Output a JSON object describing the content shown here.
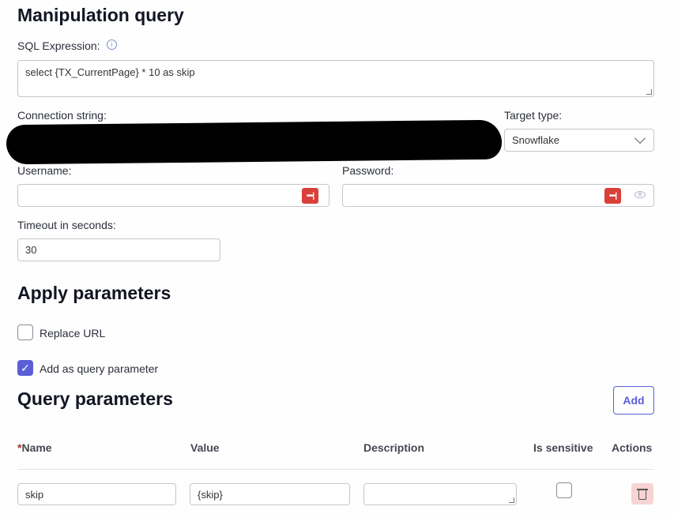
{
  "manipulation": {
    "title": "Manipulation query",
    "sql_label": "SQL Expression:",
    "sql_value": "select {TX_CurrentPage} * 10 as skip",
    "connection_label": "Connection string:",
    "target_label": "Target type:",
    "target_value": "Snowflake",
    "username_label": "Username:",
    "username_value": "",
    "password_label": "Password:",
    "password_value": "",
    "timeout_label": "Timeout in seconds:",
    "timeout_value": "30"
  },
  "apply": {
    "title": "Apply parameters",
    "replace_url_label": "Replace URL",
    "replace_url_checked": false,
    "add_query_label": "Add as query parameter",
    "add_query_checked": true
  },
  "query_params": {
    "title": "Query parameters",
    "add_label": "Add",
    "required_mark": "*",
    "columns": [
      "Name",
      "Value",
      "Description",
      "Is sensitive",
      "Actions"
    ],
    "rows": [
      {
        "name": "skip",
        "value": "{skip}",
        "description": "",
        "sensitive": false
      }
    ]
  },
  "colors": {
    "accent": "#5b5fd6",
    "password_manager": "#d9403a",
    "delete_bg": "#f7d3d3"
  }
}
